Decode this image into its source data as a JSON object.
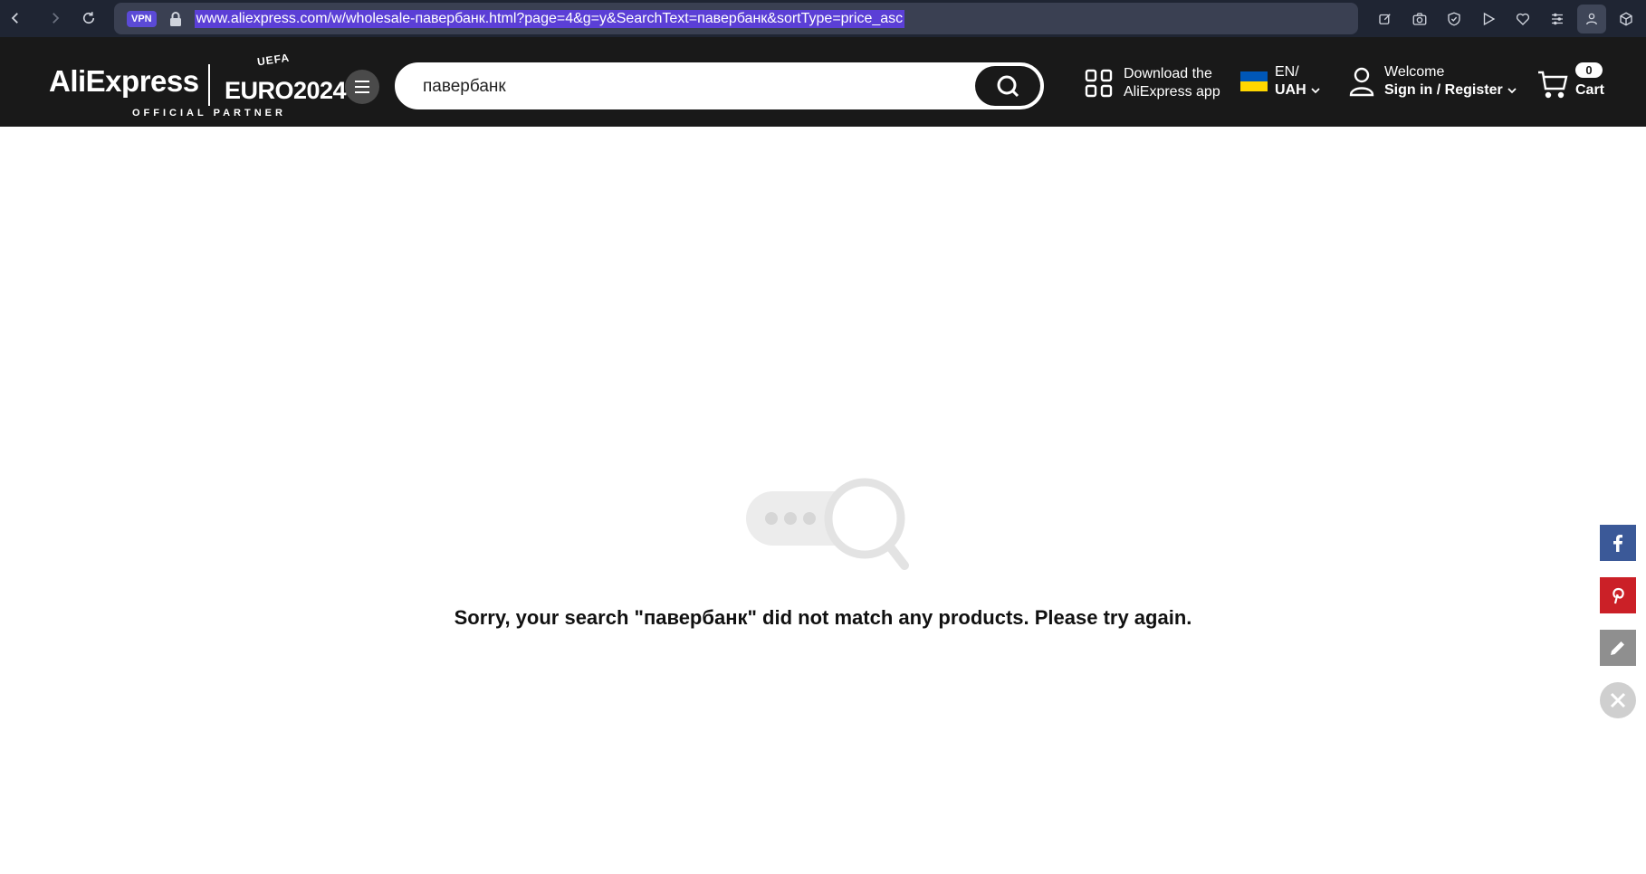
{
  "browser": {
    "vpn_label": "VPN",
    "url": "www.aliexpress.com/w/wholesale-павербанк.html?page=4&g=y&SearchText=павербанк&sortType=price_asc"
  },
  "header": {
    "logo_text": "AliExpress",
    "euro_text": "EURO2024",
    "uefa_text": "UEFA",
    "partner_text": "OFFICIAL PARTNER",
    "search_value": "павербанк",
    "download_line1": "Download the",
    "download_line2": "AliExpress app",
    "lang_line1": "EN/",
    "lang_line2": "UAH",
    "account_line1": "Welcome",
    "account_line2": "Sign in / Register",
    "cart_count": "0",
    "cart_label": "Cart"
  },
  "main": {
    "empty_message": "Sorry, your search \"павербанк\" did not match any products. Please try again."
  },
  "colors": {
    "header_bg": "#191919",
    "browser_bg": "#1f2533",
    "url_highlight": "#5b3fd6",
    "facebook": "#3b5998",
    "pinterest": "#cb2027"
  }
}
